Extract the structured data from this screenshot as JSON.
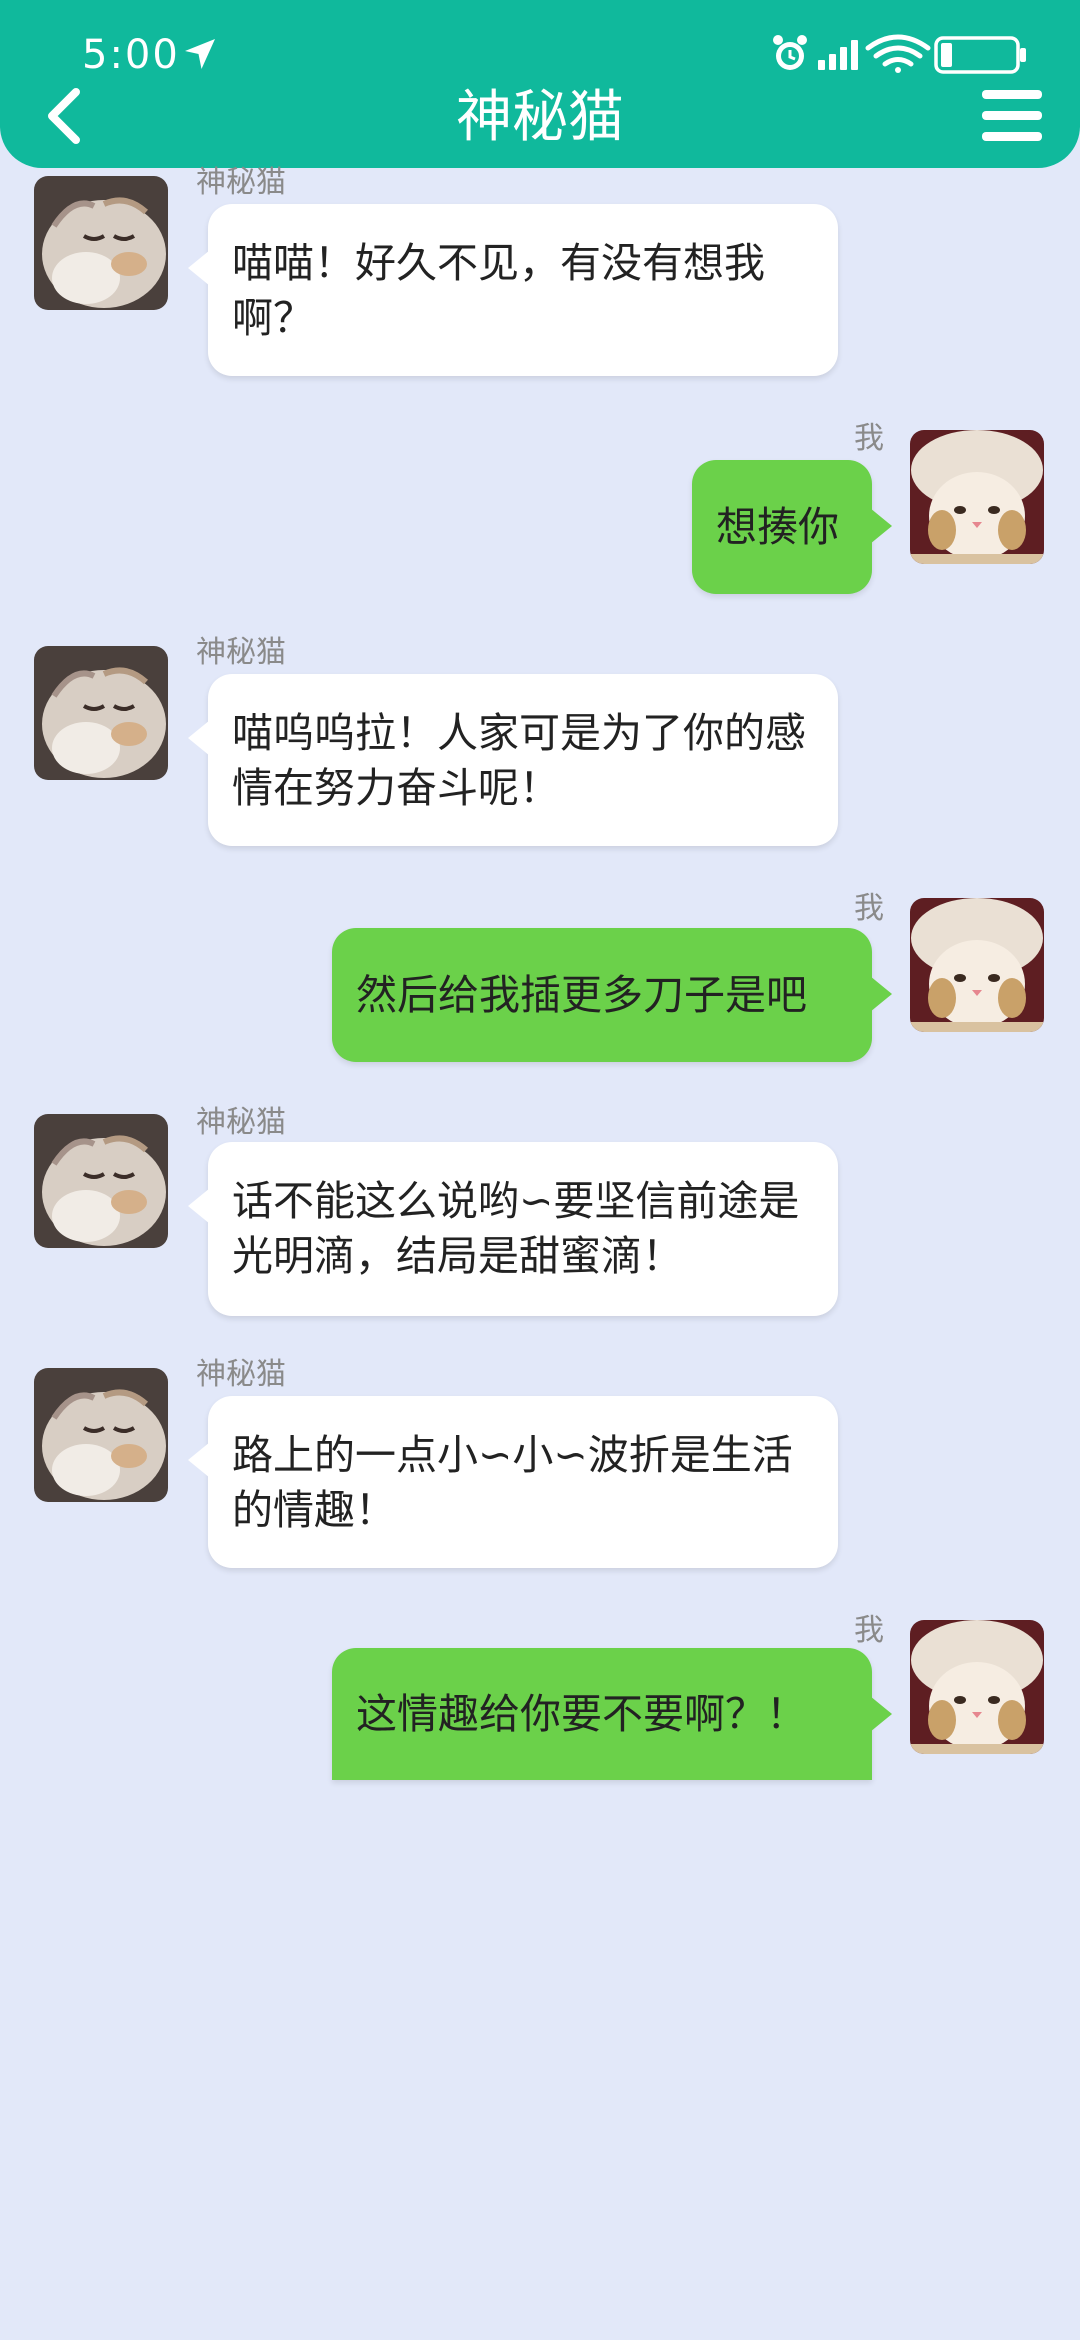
{
  "status_bar": {
    "time": "5:00",
    "icons": [
      "location-arrow-icon",
      "alarm-clock-icon",
      "signal-icon",
      "wifi-icon",
      "battery-icon"
    ]
  },
  "header": {
    "title": "神秘猫",
    "back_icon": "chevron-left-icon",
    "menu_icon": "hamburger-menu-icon"
  },
  "contact": {
    "name": "神秘猫"
  },
  "me": {
    "name": "我"
  },
  "colors": {
    "header_bg": "#10b99c",
    "page_bg": "#e2e8f9",
    "incoming_bubble": "#ffffff",
    "outgoing_bubble": "#6bd14a"
  },
  "messages": [
    {
      "from": "contact",
      "sender": "神秘猫",
      "text": "喵喵！好久不见，有没有想我啊？"
    },
    {
      "from": "me",
      "sender": "我",
      "text": "想揍你"
    },
    {
      "from": "contact",
      "sender": "神秘猫",
      "text": "喵呜呜拉！人家可是为了你的感情在努力奋斗呢！"
    },
    {
      "from": "me",
      "sender": "我",
      "text": "然后给我插更多刀子是吧"
    },
    {
      "from": "contact",
      "sender": "神秘猫",
      "text": "话不能这么说哟∽要坚信前途是光明滴，结局是甜蜜滴！"
    },
    {
      "from": "contact",
      "sender": "神秘猫",
      "text": "路上的一点小∽小∽波折是生活的情趣！"
    },
    {
      "from": "me",
      "sender": "我",
      "text": "这情趣给你要不要啊？！"
    }
  ]
}
